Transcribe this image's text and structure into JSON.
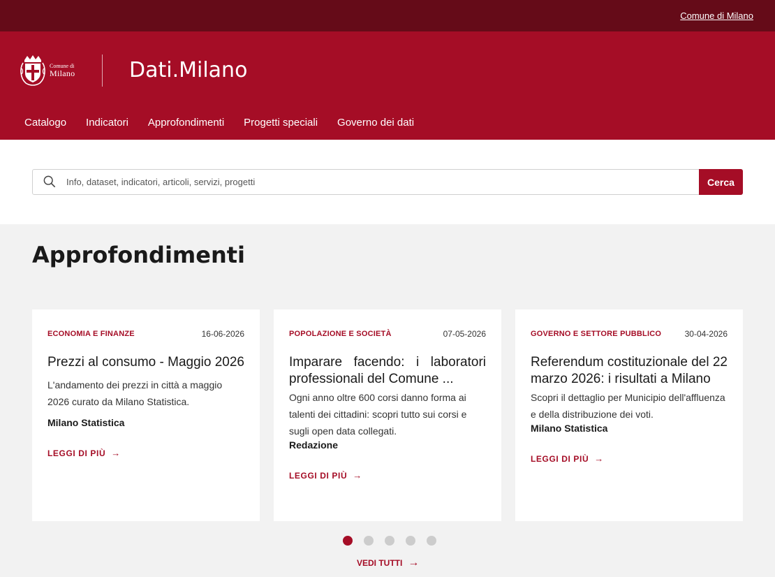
{
  "topbar": {
    "link_label": "Comune di Milano"
  },
  "header": {
    "logo": {
      "small": "Comune di",
      "big": "Milano"
    },
    "site_title": "Dati.Milano",
    "nav": [
      {
        "label": "Catalogo"
      },
      {
        "label": "Indicatori"
      },
      {
        "label": "Approfondimenti"
      },
      {
        "label": "Progetti speciali"
      },
      {
        "label": "Governo dei dati"
      }
    ]
  },
  "search": {
    "placeholder": "Info, dataset, indicatori, articoli, servizi, progetti",
    "button_label": "Cerca",
    "icon": "search-icon"
  },
  "section": {
    "title": "Approfondimenti",
    "cards": [
      {
        "category": "ECONOMIA E FINANZE",
        "date": "16-06-2026",
        "title": "Prezzi al consumo - Maggio 2026",
        "description": "L'andamento dei prezzi in città a maggio 2026 curato da Milano Statistica.",
        "author": "Milano Statistica",
        "link_label": "LEGGI DI PIÙ"
      },
      {
        "category": "POPOLAZIONE E SOCIETÀ",
        "date": "07-05-2026",
        "title": "Imparare facendo: i laboratori professionali del Comune ...",
        "description": "Ogni anno oltre 600 corsi danno forma ai talenti dei cittadini: scopri tutto sui corsi e sugli open data collegati.",
        "author": "Redazione",
        "link_label": "LEGGI DI PIÙ"
      },
      {
        "category": "GOVERNO E SETTORE PUBBLICO",
        "date": "30-04-2026",
        "title": "Referendum costituzionale del 22 marzo 2026: i risultati a Milano",
        "description": "Scopri il dettaglio per Municipio dell'affluenza e della distribuzione dei voti.",
        "author": "Milano Statistica",
        "link_label": "LEGGI DI PIÙ"
      }
    ],
    "carousel": {
      "total": 5,
      "active": 1
    },
    "see_all_label": "VEDI TUTTI"
  },
  "colors": {
    "brand": "#a50d26",
    "brand_dark": "#650b18",
    "dot_inactive": "#cccccc"
  }
}
